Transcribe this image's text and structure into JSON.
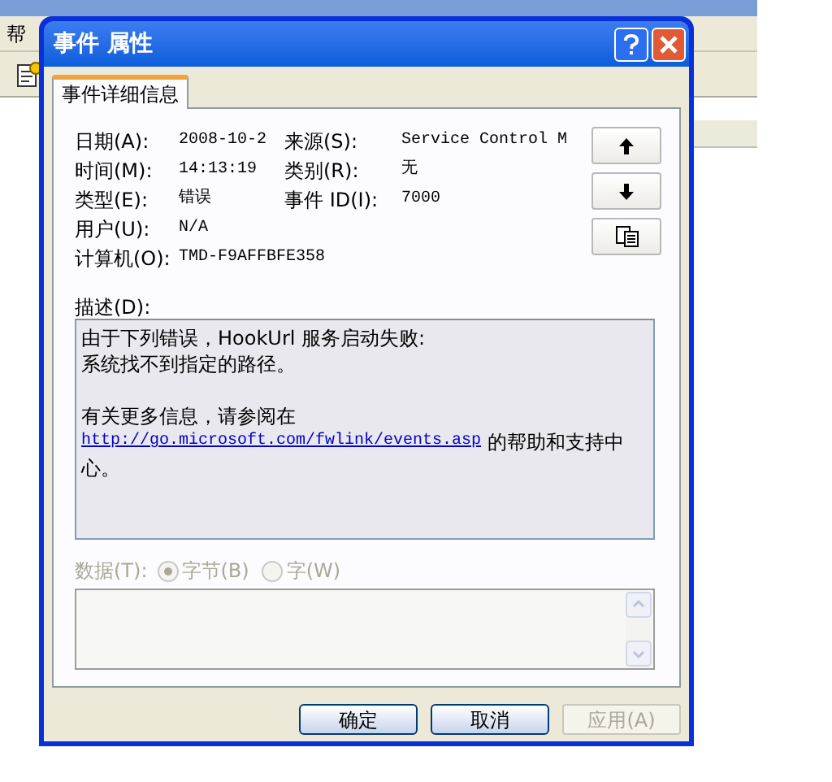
{
  "background_window": {
    "menu": [
      {
        "label": "帮"
      }
    ]
  },
  "dialog": {
    "title": "事件 属性",
    "tabs": [
      {
        "label": "事件详细信息",
        "selected": true
      }
    ],
    "fields": [
      [
        {
          "label": "日期(A):",
          "value": "2008-10-2"
        },
        {
          "label": "来源(S):",
          "value": "Service Control M"
        }
      ],
      [
        {
          "label": "时间(M):",
          "value": "14:13:19"
        },
        {
          "label": "类别(R):",
          "value": "无"
        }
      ],
      [
        {
          "label": "类型(E):",
          "value": "错误"
        },
        {
          "label": "事件 ID(I):",
          "value": "7000"
        }
      ],
      [
        {
          "label": "用户(U):",
          "value": "N/A"
        }
      ],
      [
        {
          "label": "计算机(O):",
          "value": "TMD-F9AFFBFE358"
        }
      ]
    ],
    "description": {
      "label": "描述(D):",
      "lines": [
        {
          "kind": "text",
          "text": "由于下列错误，HookUrl 服务启动失败:"
        },
        {
          "kind": "text",
          "text": "系统找不到指定的路径。"
        },
        {
          "kind": "gap"
        },
        {
          "kind": "text",
          "text": "有关更多信息，请参阅在"
        },
        {
          "kind": "link",
          "link": "http://go.microsoft.com/fwlink/events.asp",
          "text": "的帮助和支持中"
        },
        {
          "kind": "text",
          "text": "心。"
        }
      ]
    },
    "data": {
      "label": "数据(T):",
      "disabled": true,
      "options": [
        {
          "label": "字节(B)",
          "selected": true
        },
        {
          "label": "字(W)",
          "selected": false
        }
      ]
    },
    "buttons": [
      {
        "label": "确定",
        "disabled": false
      },
      {
        "label": "取消",
        "disabled": false
      },
      {
        "label": "应用(A)",
        "disabled": true
      }
    ]
  }
}
